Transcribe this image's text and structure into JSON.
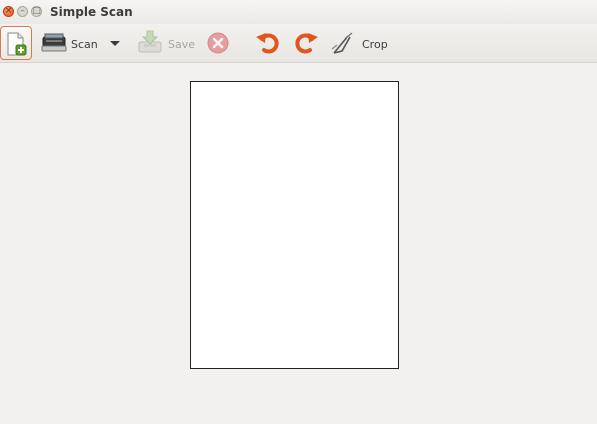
{
  "window": {
    "title": "Simple Scan",
    "controls": {
      "close": "×",
      "minimize": "–",
      "maximize": "□"
    }
  },
  "toolbar": {
    "new_icon": "new-document-icon",
    "scan_label": "Scan",
    "scan_icon": "scanner-icon",
    "scan_menu_icon": "chevron-down-icon",
    "save_label": "Save",
    "save_icon": "save-icon",
    "save_enabled": false,
    "cancel_icon": "cancel-icon",
    "rotate_left_icon": "rotate-left-icon",
    "rotate_right_icon": "rotate-right-icon",
    "crop_label": "Crop",
    "crop_icon": "crop-icon"
  },
  "colors": {
    "accent": "#e2561c",
    "background": "#f2f1f0",
    "page": "#ffffff"
  }
}
